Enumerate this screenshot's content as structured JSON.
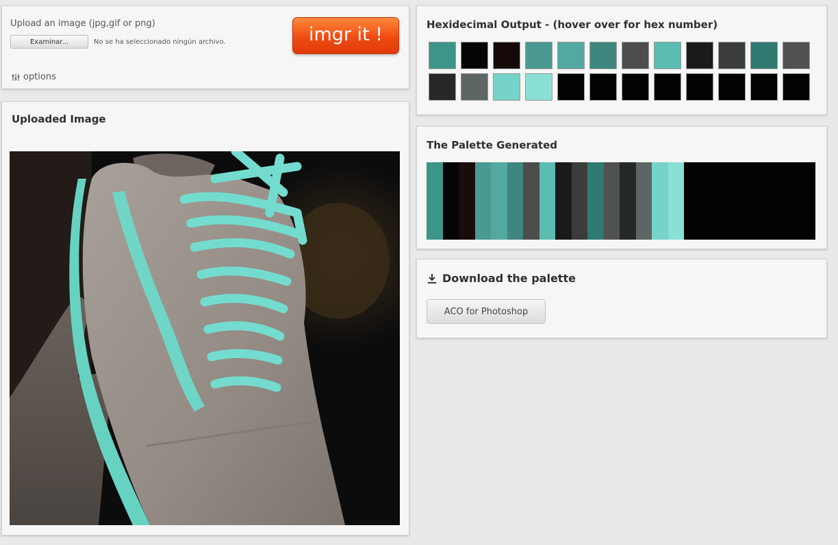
{
  "upload": {
    "label": "Upload an image (jpg,gif or png)",
    "file_button": "Examinar...",
    "file_status": "No se ha seleccionado ningún archivo.",
    "submit": "imgr it !",
    "options": "options"
  },
  "image_panel": {
    "title": "Uploaded Image"
  },
  "hex_panel": {
    "title": "Hexidecimal Output - (hover over for hex number)",
    "swatches": [
      "#3d9488",
      "#050505",
      "#150a08",
      "#4b9a92",
      "#54a8a2",
      "#3f867e",
      "#4d4d4d",
      "#5bbcb1",
      "#1a1a18",
      "#3b3d3b",
      "#2f7a71",
      "#4f5250",
      "#262826",
      "#5d6664",
      "#75d3c9",
      "#8be0d6",
      "#030303",
      "#020202",
      "#020202",
      "#020202",
      "#020202",
      "#020202",
      "#020202",
      "#020202"
    ]
  },
  "palette_panel": {
    "title": "The Palette Generated",
    "stripes": [
      "#3d9488",
      "#050505",
      "#1a0c0a",
      "#4b9a92",
      "#54a8a2",
      "#3f867e",
      "#4d4d4d",
      "#5bbcb1",
      "#1a1a18",
      "#3b3d3b",
      "#2f7a71",
      "#4f5250",
      "#262826",
      "#5d6664",
      "#75d3c9",
      "#8be0d6",
      "#030303"
    ]
  },
  "download_panel": {
    "title": "Download the palette",
    "aco_button": "ACO for Photoshop"
  }
}
